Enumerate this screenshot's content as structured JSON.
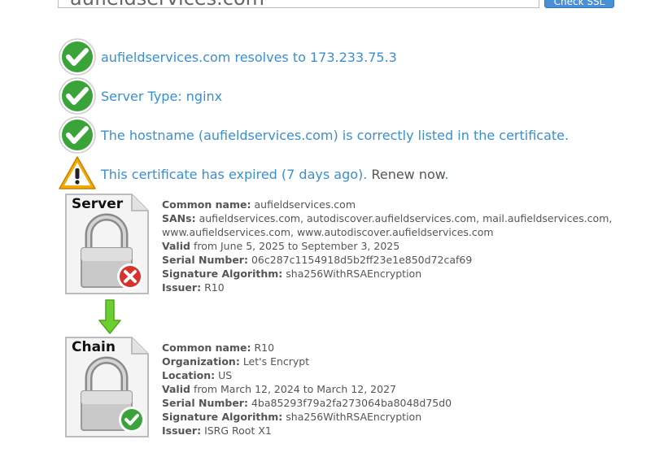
{
  "search": {
    "value": "aufieldservices.com",
    "button_label": "Check SSL"
  },
  "checks": [
    {
      "status": "ok",
      "text": "aufieldservices.com resolves to 173.233.75.3"
    },
    {
      "status": "ok",
      "text": "Server Type: nginx"
    },
    {
      "status": "ok",
      "text": "The hostname (aufieldservices.com) is correctly listed in the certificate."
    },
    {
      "status": "warning",
      "text": "This certificate has expired (7 days ago).",
      "link": "Renew now",
      "suffix": "."
    }
  ],
  "server_cert": {
    "icon_label": "Server",
    "common_name_label": "Common name:",
    "common_name": "aufieldservices.com",
    "sans_label": "SANs:",
    "sans_line1": "aufieldservices.com, autodiscover.aufieldservices.com, mail.aufieldservices.com,",
    "sans_line2": "www.aufieldservices.com, www.autodiscover.aufieldservices.com",
    "valid_label": "Valid",
    "valid_text": "from June 5, 2025 to September 3, 2025",
    "serial_label": "Serial Number:",
    "serial": "06c287c1154918d5b2ff23e1e850d72caf69",
    "sig_label": "Signature Algorithm:",
    "sig": "sha256WithRSAEncryption",
    "issuer_label": "Issuer:",
    "issuer": "R10"
  },
  "chain_cert": {
    "icon_label": "Chain",
    "common_name_label": "Common name:",
    "common_name": "R10",
    "org_label": "Organization:",
    "org": "Let's Encrypt",
    "location_label": "Location:",
    "location": "US",
    "valid_label": "Valid",
    "valid_text": "from March 12, 2024 to March 12, 2027",
    "serial_label": "Serial Number:",
    "serial": "4ba85293f79a2fa273064ba8048d75d0",
    "sig_label": "Signature Algorithm:",
    "sig": "sha256WithRSAEncryption",
    "issuer_label": "Issuer:",
    "issuer": "ISRG Root X1"
  },
  "colors": {
    "link": "#3b8fcf",
    "ok": "#3aa33a",
    "warning": "#f2a900",
    "error": "#d9322b",
    "button": "#4a90d9"
  }
}
